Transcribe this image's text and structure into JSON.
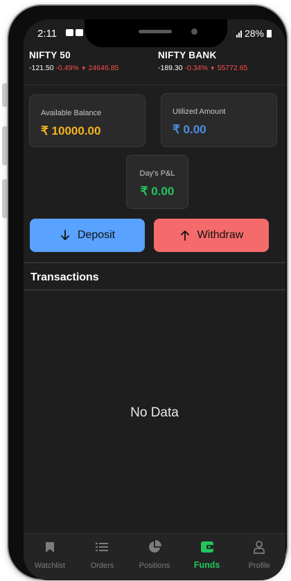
{
  "status_bar": {
    "time": "2:11",
    "battery": "28%"
  },
  "ticker": [
    {
      "name": "NIFTY 50",
      "change": "-121.50",
      "percent": "-0.49%",
      "price": "24646.85"
    },
    {
      "name": "NIFTY BANK",
      "change": "-189.30",
      "percent": "-0.34%",
      "price": "55772.65"
    }
  ],
  "balances": {
    "available_label": "Available Balance",
    "available_value": "₹ 10000.00",
    "utilized_label": "Utilized Amount",
    "utilized_value": "₹ 0.00",
    "pnl_label": "Day's P&L",
    "pnl_value": "₹ 0.00"
  },
  "actions": {
    "deposit": "Deposit",
    "withdraw": "Withdraw"
  },
  "transactions": {
    "title": "Transactions",
    "empty": "No Data"
  },
  "nav": [
    {
      "label": "Watchlist",
      "icon": "bookmark-icon",
      "active": false
    },
    {
      "label": "Orders",
      "icon": "list-icon",
      "active": false
    },
    {
      "label": "Positions",
      "icon": "pie-chart-icon",
      "active": false
    },
    {
      "label": "Funds",
      "icon": "wallet-icon",
      "active": true
    },
    {
      "label": "Profile",
      "icon": "user-icon",
      "active": false
    }
  ],
  "colors": {
    "available": "#f5b51c",
    "utilized": "#4a90e2",
    "pnl": "#22c55e",
    "deposit": "#5aa2ff",
    "withdraw": "#f56b6b",
    "negative": "#ff4d4d"
  }
}
